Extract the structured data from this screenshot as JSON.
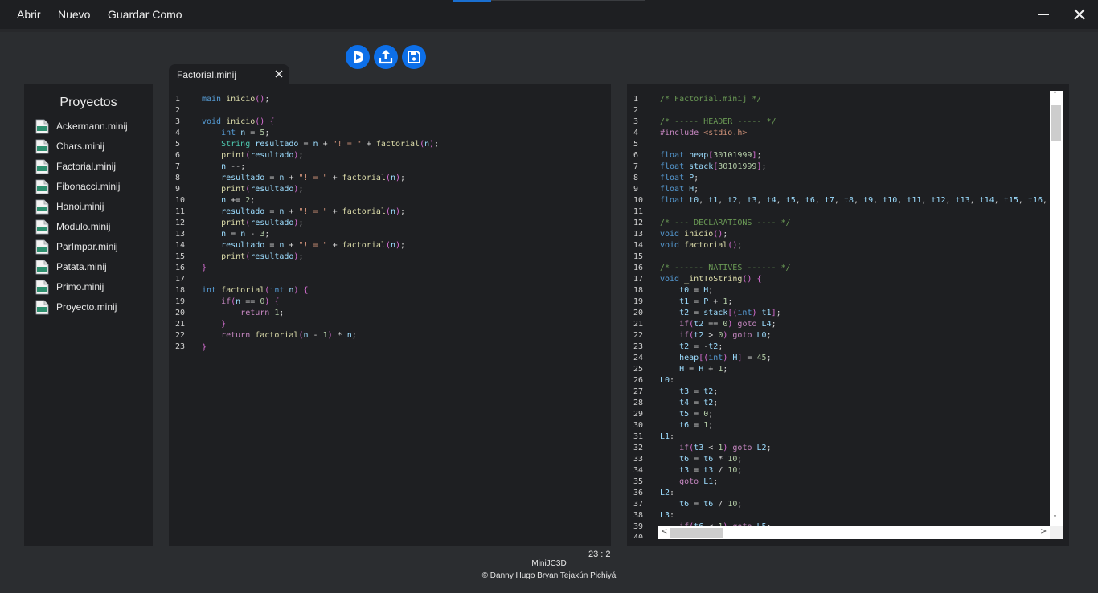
{
  "menu": {
    "open": "Abrir",
    "new": "Nuevo",
    "save_as": "Guardar Como"
  },
  "icons": {
    "minimize": "minimize-icon",
    "close": "close-icon",
    "run": "play-icon",
    "upload": "upload-icon",
    "save": "save-icon",
    "file": "file-icon"
  },
  "colors": {
    "accent": "#0d6fe8",
    "panel": "#1e1f22",
    "background": "#2b2d30"
  },
  "tab": {
    "label": "Factorial.minij",
    "close": "×"
  },
  "sidebar": {
    "title": "Proyectos",
    "items": [
      "Ackermann.minij",
      "Chars.minij",
      "Factorial.minij",
      "Fibonacci.minij",
      "Hanoi.minij",
      "Modulo.minij",
      "ParImpar.minij",
      "Patata.minij",
      "Primo.minij",
      "Proyecto.minij"
    ]
  },
  "editor": {
    "lines": [
      "main inicio();",
      "",
      "void inicio() {",
      "    int n = 5;",
      "    String resultado = n + \"! = \" + factorial(n);",
      "    print(resultado);",
      "    n --;",
      "    resultado = n + \"! = \" + factorial(n);",
      "    print(resultado);",
      "    n += 2;",
      "    resultado = n + \"! = \" + factorial(n);",
      "    print(resultado);",
      "    n = n - 3;",
      "    resultado = n + \"! = \" + factorial(n);",
      "    print(resultado);",
      "}",
      "",
      "int factorial(int n) {",
      "    if(n == 0) {",
      "        return 1;",
      "    }",
      "    return factorial(n - 1) * n;",
      "}"
    ]
  },
  "output": {
    "lines": [
      "/* Factorial.minij */",
      "",
      "/* ----- HEADER ----- */",
      "#include <stdio.h>",
      "",
      "float heap[30101999];",
      "float stack[30101999];",
      "float P;",
      "float H;",
      "float t0, t1, t2, t3, t4, t5, t6, t7, t8, t9, t10, t11, t12, t13, t14, t15, t16,",
      "",
      "/* --- DECLARATIONS ---- */",
      "void inicio();",
      "void factorial();",
      "",
      "/* ------ NATIVES ------ */",
      "void _intToString() {",
      "    t0 = H;",
      "    t1 = P + 1;",
      "    t2 = stack[(int) t1];",
      "    if(t2 == 0) goto L4;",
      "    if(t2 > 0) goto L0;",
      "    t2 = -t2;",
      "    heap[(int) H] = 45;",
      "    H = H + 1;",
      "L0:",
      "    t3 = t2;",
      "    t4 = t2;",
      "    t5 = 0;",
      "    t6 = 1;",
      "L1:",
      "    if(t3 < 1) goto L2;",
      "    t6 = t6 * 10;",
      "    t3 = t3 / 10;",
      "    goto L1;",
      "L2:",
      "    t6 = t6 / 10;",
      "L3:",
      "    if(t6 < 1) goto L5;",
      ""
    ],
    "scroll_up": "˄",
    "scroll_down": "˅",
    "scroll_left": "<",
    "scroll_right": ">"
  },
  "status": {
    "cursor": "23 : 2"
  },
  "footer": {
    "app_name": "MiniJC3D",
    "credit": "© Danny Hugo Bryan Tejaxún Pichiyá"
  }
}
